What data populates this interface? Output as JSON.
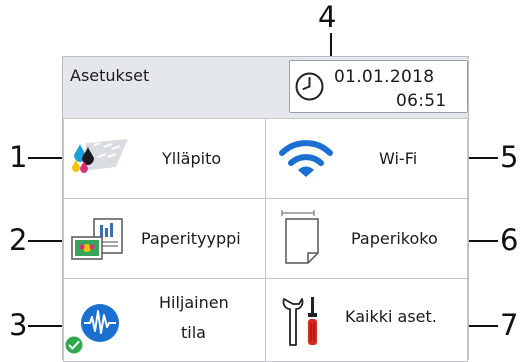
{
  "header": {
    "title": "Asetukset",
    "date": "01.01.2018",
    "time": "06:51",
    "background": "#e4e8ed"
  },
  "tiles": [
    {
      "label": "Ylläpito",
      "icon": "ink-cartridges-icon"
    },
    {
      "label": "Wi-Fi",
      "icon": "wifi-icon",
      "color": "#1b6fd1"
    },
    {
      "label": "Paperityyppi",
      "icon": "paper-type-icon"
    },
    {
      "label": "Paperikoko",
      "icon": "paper-size-icon"
    },
    {
      "label_line1": "Hiljainen",
      "label_line2": "tila",
      "icon": "quiet-mode-icon",
      "color": "#1b6fd1",
      "status_color": "#31a84f"
    },
    {
      "label": "Kaikki aset.",
      "icon": "tools-icon",
      "accent": "#d6281f"
    }
  ],
  "callouts": [
    "1",
    "2",
    "3",
    "4",
    "5",
    "6",
    "7"
  ]
}
